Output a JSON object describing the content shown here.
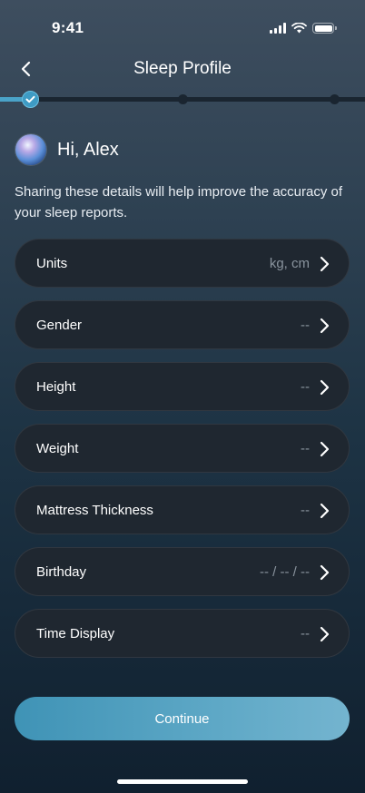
{
  "status_bar": {
    "time": "9:41"
  },
  "nav": {
    "title": "Sleep Profile"
  },
  "progress": {
    "completed_steps": 1,
    "total_steps": 3
  },
  "greeting": {
    "text": "Hi, Alex"
  },
  "intro": {
    "text": "Sharing these details will help improve the accuracy of your sleep reports."
  },
  "rows": [
    {
      "label": "Units",
      "value": "kg, cm"
    },
    {
      "label": "Gender",
      "value": "--"
    },
    {
      "label": "Height",
      "value": "--"
    },
    {
      "label": "Weight",
      "value": "--"
    },
    {
      "label": "Mattress Thickness",
      "value": "--"
    },
    {
      "label": "Birthday",
      "value": "-- / -- / --"
    },
    {
      "label": "Time Display",
      "value": "--"
    }
  ],
  "continue": {
    "label": "Continue"
  },
  "colors": {
    "accent": "#4aa3c8",
    "row_background": "#1f2730",
    "value_text": "#8a949e"
  }
}
